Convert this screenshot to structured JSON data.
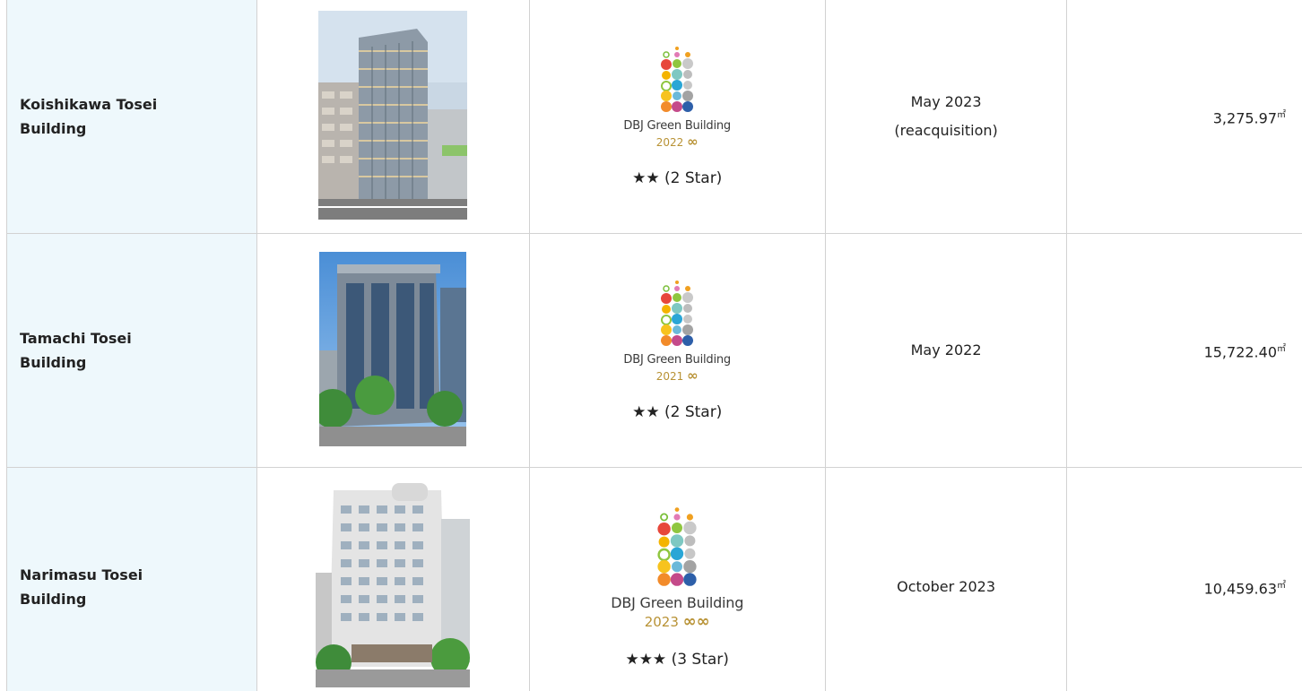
{
  "rows": [
    {
      "name": "Koishikawa Tosei Building",
      "logo_title": "DBJ Green Building",
      "logo_year": "2022",
      "rating": "★★ (2 Star)",
      "date_line1": "May 2023",
      "date_line2": "(reacquisition)",
      "area": "3,275.97",
      "area_unit": "㎡"
    },
    {
      "name": "Tamachi Tosei Building",
      "logo_title": "DBJ Green Building",
      "logo_year": "2021",
      "rating": "★★ (2 Star)",
      "date_line1": "May 2022",
      "date_line2": "",
      "area": "15,722.40",
      "area_unit": "㎡"
    },
    {
      "name": "Narimasu Tosei Building",
      "logo_title": "DBJ Green Building",
      "logo_year": "2023",
      "rating": "★★★ (3 Star)",
      "date_line1": "October 2023",
      "date_line2": "",
      "area": "10,459.63",
      "area_unit": "㎡"
    }
  ],
  "colors": {
    "header_cell_bg": "#eef8fc",
    "border": "#d2d2d2",
    "gold": "#b89235"
  },
  "icons": {
    "logo": "dbj-green-building-logo-icon",
    "infinity": "infinity-icon",
    "photo": "building-photo"
  }
}
